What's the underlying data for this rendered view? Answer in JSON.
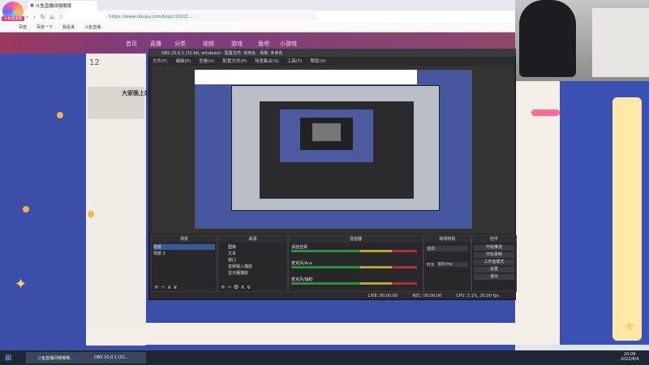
{
  "browser": {
    "tab_title": "斗鱼直播间哦哦哦",
    "address": "https://www.douyu.com/topic/2022/...",
    "nav_icons": [
      "back-icon",
      "forward-icon",
      "refresh-icon",
      "home-icon",
      "star-icon"
    ],
    "bookmarks": [
      "百度",
      "百度一下",
      "我是谁",
      "斗鱼直播"
    ],
    "logo_label": "斗鱼极速版"
  },
  "douyu": {
    "header_nav": [
      "首页",
      "直播",
      "分类",
      "视频",
      "游戏",
      "鱼吧",
      "小游戏"
    ],
    "room_number": "12",
    "room_title": "大家晚上好"
  },
  "obs": {
    "title": "OBS 25.0.1 (32-bit, windows) - 配置文件: 未命名 - 场景: 未命名",
    "menu": [
      "文件(F)",
      "编辑(E)",
      "查看(V)",
      "配置文件(P)",
      "场景集合(S)",
      "工具(T)",
      "帮助(H)"
    ],
    "docks": {
      "scenes": {
        "title": "场景",
        "items": [
          "场景",
          "场景 2"
        ]
      },
      "sources": {
        "title": "来源",
        "items": [
          "图像",
          "文本",
          "窗口",
          "音频输入捕获",
          "显示器捕获"
        ]
      },
      "mixer": {
        "title": "混音器",
        "tracks": [
          "桌面音频",
          "麦克风/Aux",
          "麦克风/辅助"
        ]
      },
      "transitions": {
        "title": "转场特效",
        "type": "淡出",
        "duration_label": "时长",
        "duration": "300 ms"
      },
      "controls": {
        "title": "控件",
        "buttons": [
          "开始推流",
          "开始录制",
          "工作室模式",
          "设置",
          "退出"
        ]
      }
    },
    "status": {
      "live": "LIVE: 00:00:00",
      "rec": "REC: 00:00:00",
      "cpu": "CPU: 3.1%, 30.00 fps"
    }
  },
  "taskbar": {
    "items": [
      "斗鱼直播间哦哦哦...",
      "OBS 25.0.1 (32..."
    ],
    "time": "20:09",
    "date": "2022/8/4"
  },
  "colors": {
    "accent": "#ff6a99",
    "obs_bg": "#2b2b2e",
    "page_bg": "#3c4fa8"
  }
}
